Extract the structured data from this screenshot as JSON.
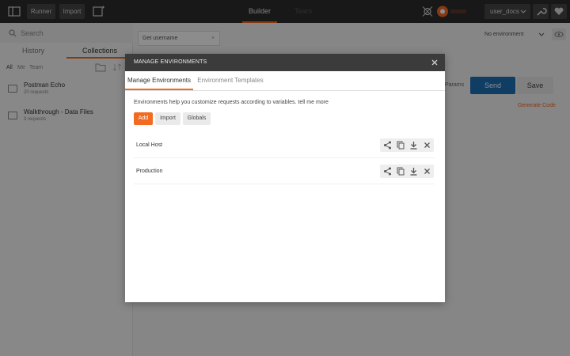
{
  "topbar": {
    "runner_label": "Runner",
    "import_label": "Import",
    "builder_tab": "Builder",
    "team_tab": "Team Library",
    "user": "user_docs"
  },
  "sidebar": {
    "search_placeholder": "Search",
    "tabs": [
      "History",
      "Collections"
    ],
    "filters": [
      "All",
      "Me",
      "Team"
    ],
    "collections": [
      {
        "name": "Postman Echo",
        "sub": "20 requests"
      },
      {
        "name": "Walkthrough - Data Files",
        "sub": "3 requests"
      }
    ]
  },
  "main": {
    "request_tab": "Get username",
    "environment": "No environment",
    "params_fragment": "Params",
    "send_label": "Send",
    "save_label": "Save",
    "generate_code": "Generate Code"
  },
  "modal": {
    "title": "MANAGE ENVIRONMENTS",
    "tabs": [
      "Manage Environments",
      "Environment Templates"
    ],
    "intro": "Environments help you customize requests according to variables. tell me more",
    "buttons": {
      "add": "Add",
      "import": "Import",
      "globals": "Globals"
    },
    "environments": [
      {
        "name": "Local Host"
      },
      {
        "name": "Production"
      }
    ]
  },
  "colors": {
    "accent": "#f26b21",
    "send_blue": "#1d70b7",
    "header_dark": "#2c2c2c"
  }
}
